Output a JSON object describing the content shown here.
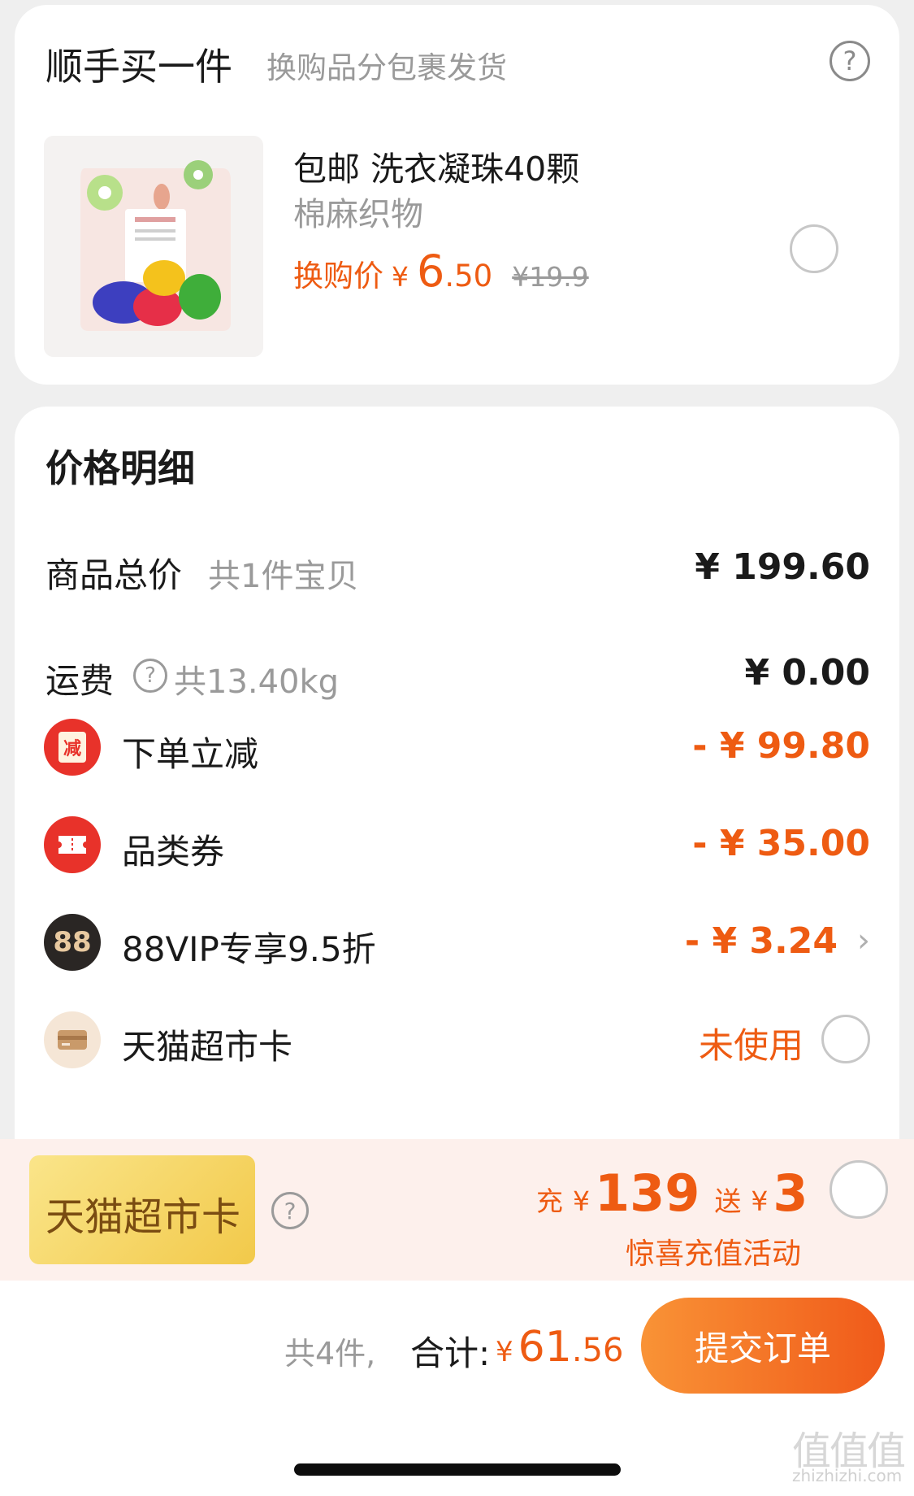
{
  "addon": {
    "title": "顺手买一件",
    "subtitle": "换购品分包裹发货",
    "product": {
      "name": "包邮 洗衣凝珠40颗",
      "category": "棉麻织物",
      "price_label": "换购价",
      "currency": "¥",
      "price_int": "6",
      "price_dec": ".50",
      "original_price": "¥19.9"
    }
  },
  "price_details": {
    "title": "价格明细",
    "goods_total": {
      "label": "商品总价",
      "sub": "共1件宝贝",
      "value": "¥ 199.60"
    },
    "shipping": {
      "label": "运费",
      "sub": "共13.40kg",
      "value": "¥ 0.00"
    },
    "instant_discount": {
      "label": "下单立减",
      "icon_text": "减",
      "value": "- ¥ 99.80"
    },
    "category_coupon": {
      "label": "品类券",
      "value": "- ¥ 35.00"
    },
    "vip": {
      "label": "88VIP专享9.5折",
      "icon_text": "88",
      "value": "- ¥ 3.24"
    },
    "supermarket_card": {
      "label": "天猫超市卡",
      "value": "未使用"
    }
  },
  "banner": {
    "card_label": "天猫超市卡",
    "charge_label": "充",
    "currency": "¥",
    "charge_amount": "139",
    "gift_label": "送",
    "gift_amount": "3",
    "note": "惊喜充值活动"
  },
  "footer": {
    "count_text": "共4件,",
    "total_label": "合计:",
    "currency": "¥",
    "total_int": "61",
    "total_dec": ".56",
    "submit_label": "提交订单",
    "watermark": "值值值",
    "watermark_url": "zhizhizhi.com"
  },
  "colors": {
    "accent": "#ee5b12",
    "submit_from": "#f99336",
    "submit_to": "#f05a1a"
  }
}
